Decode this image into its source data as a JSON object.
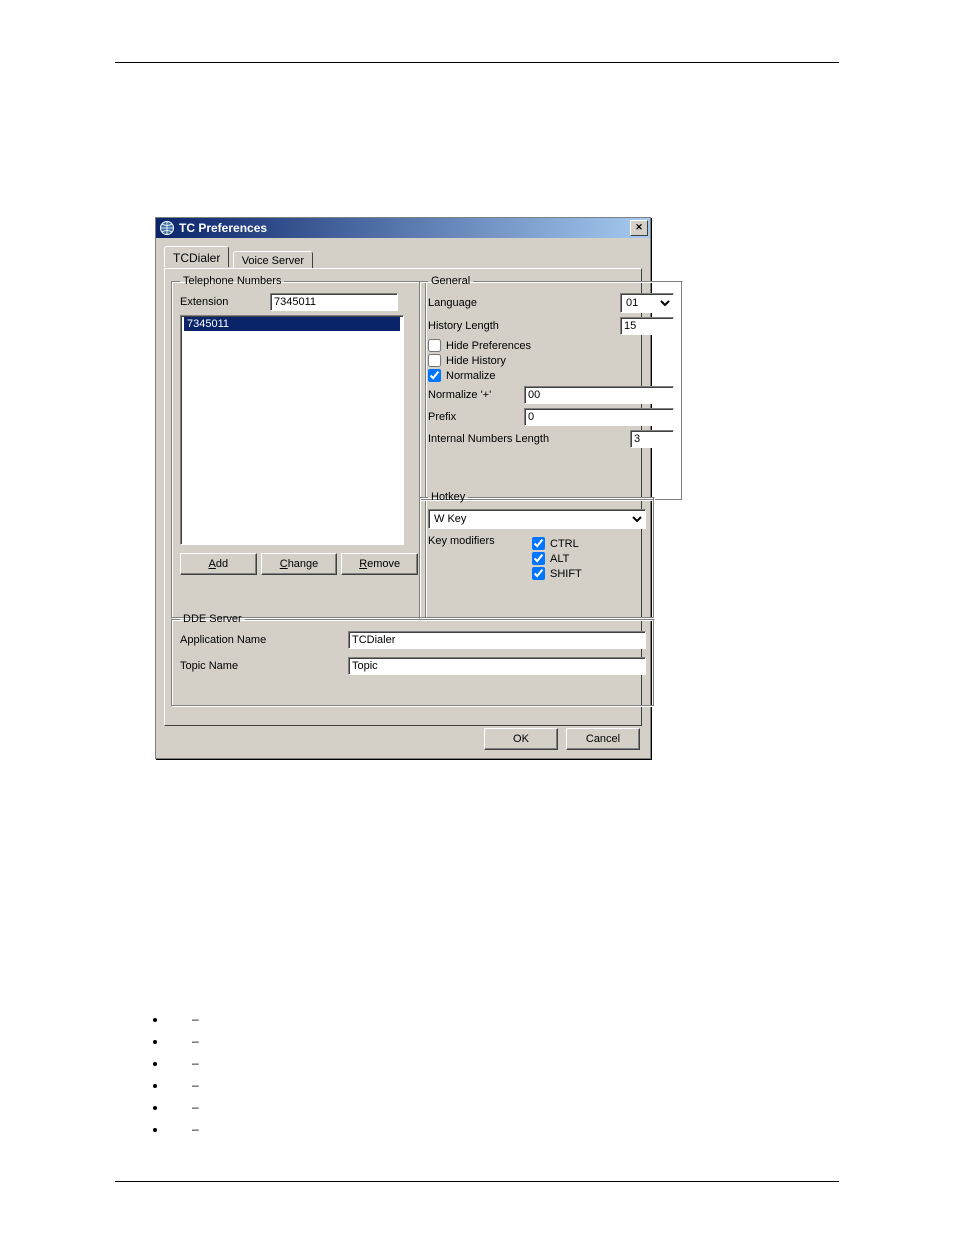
{
  "window": {
    "title": "TC Preferences"
  },
  "tabs": {
    "tcdialer": "TCDialer",
    "voiceserver": "Voice Server"
  },
  "telephone": {
    "legend": "Telephone Numbers",
    "extension_label": "Extension",
    "extension_value": "7345011",
    "list_item": "7345011",
    "add": "Add",
    "change": "Change",
    "remove": "Remove"
  },
  "general": {
    "legend": "General",
    "language_label": "Language",
    "language_value": "01",
    "history_length_label": "History Length",
    "history_length_value": "15",
    "hide_preferences": "Hide Preferences",
    "hide_history": "Hide History",
    "normalize": "Normalize",
    "normalize_plus_label": "Normalize '+'",
    "normalize_plus_value": "00",
    "prefix_label": "Prefix",
    "prefix_value": "0",
    "intnum_label": "Internal Numbers Length",
    "intnum_value": "3"
  },
  "hotkey": {
    "legend": "Hotkey",
    "key_value": "W Key",
    "modifiers_label": "Key modifiers",
    "ctrl": "CTRL",
    "alt": "ALT",
    "shift": "SHIFT"
  },
  "dde": {
    "legend": "DDE Server",
    "appname_label": "Application Name",
    "appname_value": "TCDialer",
    "topic_label": "Topic Name",
    "topic_value": "Topic"
  },
  "buttons": {
    "ok": "OK",
    "cancel": "Cancel"
  },
  "doclist": {
    "dash": "–"
  }
}
